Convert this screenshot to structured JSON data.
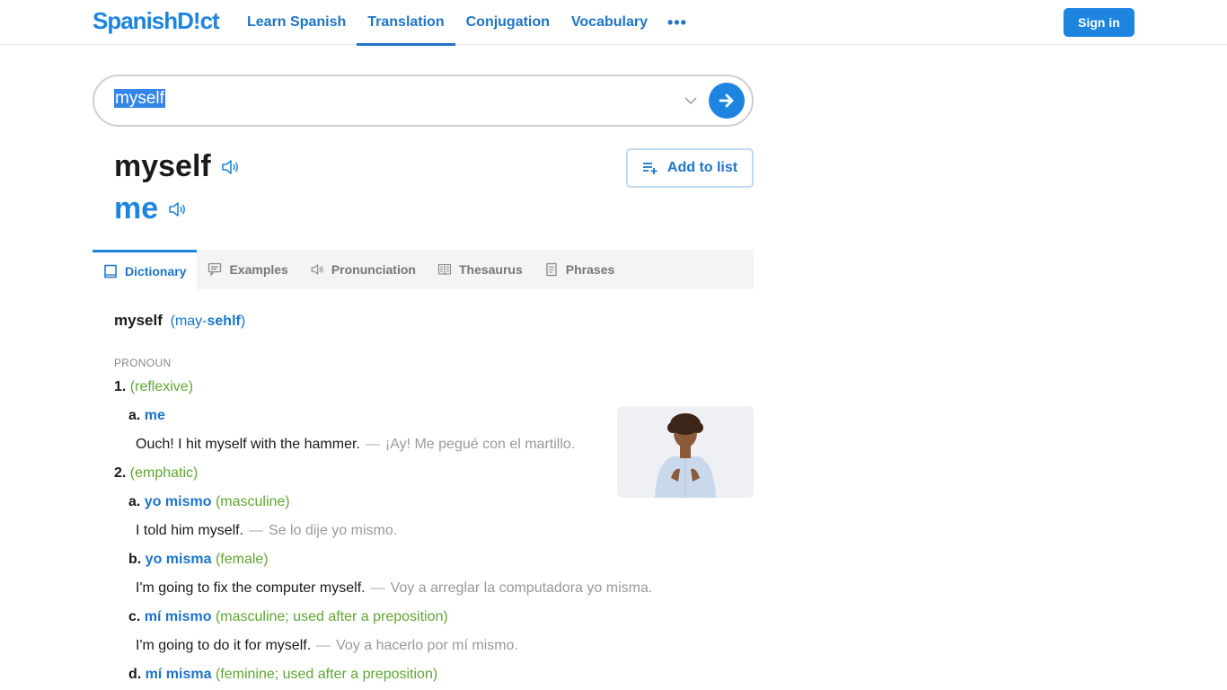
{
  "header": {
    "logo": "SpanishD!ct",
    "nav": [
      {
        "label": "Learn Spanish",
        "active": false
      },
      {
        "label": "Translation",
        "active": true
      },
      {
        "label": "Conjugation",
        "active": false
      },
      {
        "label": "Vocabulary",
        "active": false
      }
    ],
    "more_label": "•••",
    "signin_label": "Sign in"
  },
  "search": {
    "value": "myself",
    "selected": true
  },
  "headword": {
    "word": "myself",
    "translation": "me",
    "add_to_list_label": "Add to list"
  },
  "tabs": [
    {
      "label": "Dictionary",
      "icon": "book-icon",
      "active": true
    },
    {
      "label": "Examples",
      "icon": "chat-icon",
      "active": false
    },
    {
      "label": "Pronunciation",
      "icon": "speaker-icon",
      "active": false
    },
    {
      "label": "Thesaurus",
      "icon": "open-book-icon",
      "active": false
    },
    {
      "label": "Phrases",
      "icon": "document-icon",
      "active": false
    }
  ],
  "entry": {
    "word": "myself",
    "pron_open": "(may-",
    "pron_stress": "sehlf",
    "pron_close": ")",
    "pos": "PRONOUN",
    "senses": [
      {
        "num": "1.",
        "context": "(reflexive)",
        "subs": [
          {
            "letter": "a.",
            "translation": "me",
            "context": "",
            "example_en": "Ouch! I hit myself with the hammer.",
            "example_es": "¡Ay! Me pegué con el martillo."
          }
        ]
      },
      {
        "num": "2.",
        "context": "(emphatic)",
        "subs": [
          {
            "letter": "a.",
            "translation": "yo mismo",
            "context": "(masculine)",
            "example_en": "I told him myself.",
            "example_es": "Se lo dije yo mismo."
          },
          {
            "letter": "b.",
            "translation": "yo misma",
            "context": "(female)",
            "example_en": "I'm going to fix the computer myself.",
            "example_es": "Voy a arreglar la computadora yo misma."
          },
          {
            "letter": "c.",
            "translation": "mí mismo",
            "context": "(masculine; used after a preposition)",
            "example_en": "I'm going to do it for myself.",
            "example_es": "Voy a hacerlo por mí mismo."
          },
          {
            "letter": "d.",
            "translation": "mí misma",
            "context": "(feminine; used after a preposition)"
          }
        ]
      }
    ],
    "dash": "—",
    "image_alt": "man pointing at himself"
  },
  "colors": {
    "brand": "#1d85e0",
    "link": "#1d74c9",
    "context_green": "#5fa632",
    "example_es_gray": "#999999"
  }
}
